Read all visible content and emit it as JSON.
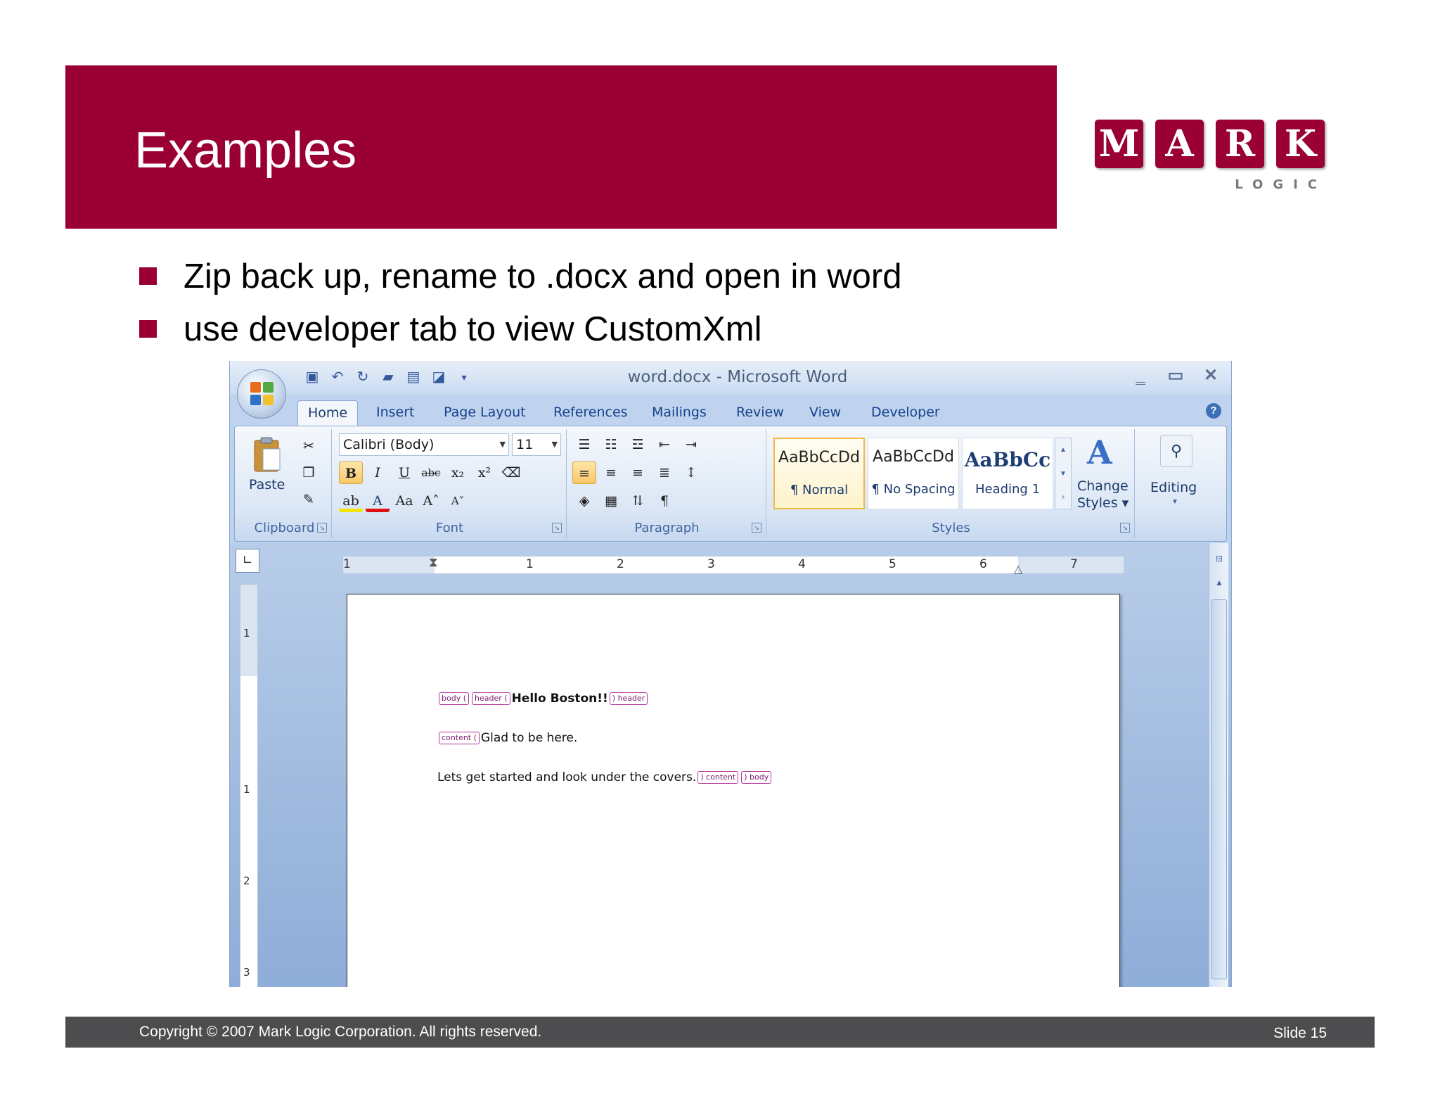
{
  "slide": {
    "title": "Examples",
    "bullets": [
      "Zip back up, rename to .docx and open in word",
      "use developer tab to view CustomXml"
    ],
    "footer_copyright": "Copyright © 2007 Mark Logic Corporation.  All rights reserved.",
    "footer_slide": "Slide 15",
    "brand_color": "#9b0034"
  },
  "logo": {
    "letters": [
      "M",
      "A",
      "R",
      "K"
    ],
    "subtitle": "LOGIC"
  },
  "word": {
    "window_title": "word.docx - Microsoft Word",
    "tabs": [
      "Home",
      "Insert",
      "Page Layout",
      "References",
      "Mailings",
      "Review",
      "View",
      "Developer"
    ],
    "active_tab": "Home",
    "ribbon": {
      "clipboard": {
        "label": "Clipboard",
        "paste": "Paste"
      },
      "font": {
        "label": "Font",
        "font_name": "Calibri (Body)",
        "font_size": "11"
      },
      "paragraph": {
        "label": "Paragraph"
      },
      "styles": {
        "label": "Styles",
        "items": [
          {
            "sample": "AaBbCcDd",
            "name": "¶ Normal"
          },
          {
            "sample": "AaBbCcDd",
            "name": "¶ No Spacing"
          },
          {
            "sample": "AaBbCc",
            "name": "Heading 1"
          }
        ],
        "change_styles": "Change Styles",
        "change_styles_line1": "Change",
        "change_styles_line2": "Styles ▾"
      },
      "editing": {
        "label": "Editing"
      }
    },
    "ruler_marks": [
      "1",
      "1",
      "2",
      "3",
      "4",
      "5",
      "6",
      "7"
    ],
    "vruler_marks": [
      "1",
      "1",
      "2",
      "3"
    ],
    "document": {
      "tags": {
        "body_open": "body",
        "header_open": "header",
        "header_close": "header",
        "content_open": "content",
        "content_close": "content",
        "body_close": "body"
      },
      "line1": "Hello Boston!!",
      "line2": "Glad to be here.",
      "line3": "Lets get started and look under the covers."
    }
  }
}
